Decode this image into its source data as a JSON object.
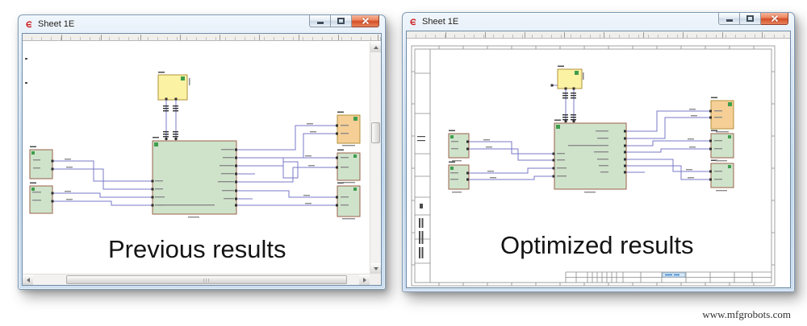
{
  "left_window": {
    "title": "Sheet 1E",
    "caption": "Previous results"
  },
  "right_window": {
    "title": "Sheet 1E",
    "caption": "Optimized results"
  },
  "watermark": "www.mfgrobots.com",
  "colors": {
    "wire": "#7878c8",
    "block_green": "#cfe3cb",
    "block_yellow": "#fcf2a4",
    "block_orange": "#f6cf96",
    "border_brown": "#9a6248",
    "border_gold": "#b2923a",
    "badge_green": "#3f9e4d",
    "titlebar_blue": "#c2d8ec",
    "close_red": "#d4502a",
    "frame_gray": "#8a8a8a"
  }
}
